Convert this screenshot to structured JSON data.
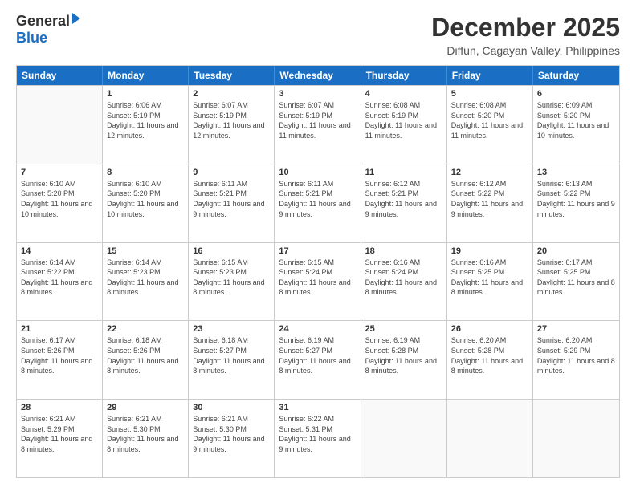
{
  "header": {
    "logo_general": "General",
    "logo_blue": "Blue",
    "month": "December 2025",
    "location": "Diffun, Cagayan Valley, Philippines"
  },
  "days": [
    "Sunday",
    "Monday",
    "Tuesday",
    "Wednesday",
    "Thursday",
    "Friday",
    "Saturday"
  ],
  "rows": [
    [
      {
        "date": "",
        "sunrise": "",
        "sunset": "",
        "daylight": ""
      },
      {
        "date": "1",
        "sunrise": "6:06 AM",
        "sunset": "5:19 PM",
        "daylight": "11 hours and 12 minutes."
      },
      {
        "date": "2",
        "sunrise": "6:07 AM",
        "sunset": "5:19 PM",
        "daylight": "11 hours and 12 minutes."
      },
      {
        "date": "3",
        "sunrise": "6:07 AM",
        "sunset": "5:19 PM",
        "daylight": "11 hours and 11 minutes."
      },
      {
        "date": "4",
        "sunrise": "6:08 AM",
        "sunset": "5:19 PM",
        "daylight": "11 hours and 11 minutes."
      },
      {
        "date": "5",
        "sunrise": "6:08 AM",
        "sunset": "5:20 PM",
        "daylight": "11 hours and 11 minutes."
      },
      {
        "date": "6",
        "sunrise": "6:09 AM",
        "sunset": "5:20 PM",
        "daylight": "11 hours and 10 minutes."
      }
    ],
    [
      {
        "date": "7",
        "sunrise": "6:10 AM",
        "sunset": "5:20 PM",
        "daylight": "11 hours and 10 minutes."
      },
      {
        "date": "8",
        "sunrise": "6:10 AM",
        "sunset": "5:20 PM",
        "daylight": "11 hours and 10 minutes."
      },
      {
        "date": "9",
        "sunrise": "6:11 AM",
        "sunset": "5:21 PM",
        "daylight": "11 hours and 9 minutes."
      },
      {
        "date": "10",
        "sunrise": "6:11 AM",
        "sunset": "5:21 PM",
        "daylight": "11 hours and 9 minutes."
      },
      {
        "date": "11",
        "sunrise": "6:12 AM",
        "sunset": "5:21 PM",
        "daylight": "11 hours and 9 minutes."
      },
      {
        "date": "12",
        "sunrise": "6:12 AM",
        "sunset": "5:22 PM",
        "daylight": "11 hours and 9 minutes."
      },
      {
        "date": "13",
        "sunrise": "6:13 AM",
        "sunset": "5:22 PM",
        "daylight": "11 hours and 9 minutes."
      }
    ],
    [
      {
        "date": "14",
        "sunrise": "6:14 AM",
        "sunset": "5:22 PM",
        "daylight": "11 hours and 8 minutes."
      },
      {
        "date": "15",
        "sunrise": "6:14 AM",
        "sunset": "5:23 PM",
        "daylight": "11 hours and 8 minutes."
      },
      {
        "date": "16",
        "sunrise": "6:15 AM",
        "sunset": "5:23 PM",
        "daylight": "11 hours and 8 minutes."
      },
      {
        "date": "17",
        "sunrise": "6:15 AM",
        "sunset": "5:24 PM",
        "daylight": "11 hours and 8 minutes."
      },
      {
        "date": "18",
        "sunrise": "6:16 AM",
        "sunset": "5:24 PM",
        "daylight": "11 hours and 8 minutes."
      },
      {
        "date": "19",
        "sunrise": "6:16 AM",
        "sunset": "5:25 PM",
        "daylight": "11 hours and 8 minutes."
      },
      {
        "date": "20",
        "sunrise": "6:17 AM",
        "sunset": "5:25 PM",
        "daylight": "11 hours and 8 minutes."
      }
    ],
    [
      {
        "date": "21",
        "sunrise": "6:17 AM",
        "sunset": "5:26 PM",
        "daylight": "11 hours and 8 minutes."
      },
      {
        "date": "22",
        "sunrise": "6:18 AM",
        "sunset": "5:26 PM",
        "daylight": "11 hours and 8 minutes."
      },
      {
        "date": "23",
        "sunrise": "6:18 AM",
        "sunset": "5:27 PM",
        "daylight": "11 hours and 8 minutes."
      },
      {
        "date": "24",
        "sunrise": "6:19 AM",
        "sunset": "5:27 PM",
        "daylight": "11 hours and 8 minutes."
      },
      {
        "date": "25",
        "sunrise": "6:19 AM",
        "sunset": "5:28 PM",
        "daylight": "11 hours and 8 minutes."
      },
      {
        "date": "26",
        "sunrise": "6:20 AM",
        "sunset": "5:28 PM",
        "daylight": "11 hours and 8 minutes."
      },
      {
        "date": "27",
        "sunrise": "6:20 AM",
        "sunset": "5:29 PM",
        "daylight": "11 hours and 8 minutes."
      }
    ],
    [
      {
        "date": "28",
        "sunrise": "6:21 AM",
        "sunset": "5:29 PM",
        "daylight": "11 hours and 8 minutes."
      },
      {
        "date": "29",
        "sunrise": "6:21 AM",
        "sunset": "5:30 PM",
        "daylight": "11 hours and 8 minutes."
      },
      {
        "date": "30",
        "sunrise": "6:21 AM",
        "sunset": "5:30 PM",
        "daylight": "11 hours and 9 minutes."
      },
      {
        "date": "31",
        "sunrise": "6:22 AM",
        "sunset": "5:31 PM",
        "daylight": "11 hours and 9 minutes."
      },
      {
        "date": "",
        "sunrise": "",
        "sunset": "",
        "daylight": ""
      },
      {
        "date": "",
        "sunrise": "",
        "sunset": "",
        "daylight": ""
      },
      {
        "date": "",
        "sunrise": "",
        "sunset": "",
        "daylight": ""
      }
    ]
  ]
}
